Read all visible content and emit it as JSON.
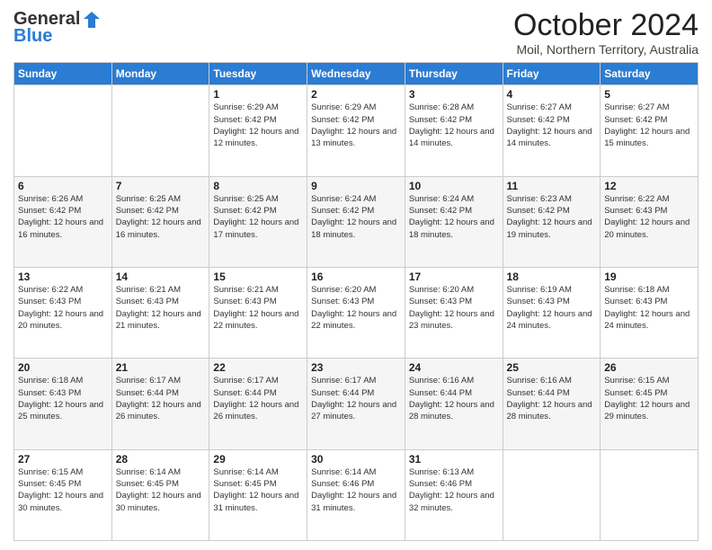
{
  "header": {
    "logo_line1": "General",
    "logo_line2": "Blue",
    "month": "October 2024",
    "location": "Moil, Northern Territory, Australia"
  },
  "weekdays": [
    "Sunday",
    "Monday",
    "Tuesday",
    "Wednesday",
    "Thursday",
    "Friday",
    "Saturday"
  ],
  "weeks": [
    [
      {
        "day": "",
        "info": ""
      },
      {
        "day": "",
        "info": ""
      },
      {
        "day": "1",
        "info": "Sunrise: 6:29 AM\nSunset: 6:42 PM\nDaylight: 12 hours and 12 minutes."
      },
      {
        "day": "2",
        "info": "Sunrise: 6:29 AM\nSunset: 6:42 PM\nDaylight: 12 hours and 13 minutes."
      },
      {
        "day": "3",
        "info": "Sunrise: 6:28 AM\nSunset: 6:42 PM\nDaylight: 12 hours and 14 minutes."
      },
      {
        "day": "4",
        "info": "Sunrise: 6:27 AM\nSunset: 6:42 PM\nDaylight: 12 hours and 14 minutes."
      },
      {
        "day": "5",
        "info": "Sunrise: 6:27 AM\nSunset: 6:42 PM\nDaylight: 12 hours and 15 minutes."
      }
    ],
    [
      {
        "day": "6",
        "info": "Sunrise: 6:26 AM\nSunset: 6:42 PM\nDaylight: 12 hours and 16 minutes."
      },
      {
        "day": "7",
        "info": "Sunrise: 6:25 AM\nSunset: 6:42 PM\nDaylight: 12 hours and 16 minutes."
      },
      {
        "day": "8",
        "info": "Sunrise: 6:25 AM\nSunset: 6:42 PM\nDaylight: 12 hours and 17 minutes."
      },
      {
        "day": "9",
        "info": "Sunrise: 6:24 AM\nSunset: 6:42 PM\nDaylight: 12 hours and 18 minutes."
      },
      {
        "day": "10",
        "info": "Sunrise: 6:24 AM\nSunset: 6:42 PM\nDaylight: 12 hours and 18 minutes."
      },
      {
        "day": "11",
        "info": "Sunrise: 6:23 AM\nSunset: 6:42 PM\nDaylight: 12 hours and 19 minutes."
      },
      {
        "day": "12",
        "info": "Sunrise: 6:22 AM\nSunset: 6:43 PM\nDaylight: 12 hours and 20 minutes."
      }
    ],
    [
      {
        "day": "13",
        "info": "Sunrise: 6:22 AM\nSunset: 6:43 PM\nDaylight: 12 hours and 20 minutes."
      },
      {
        "day": "14",
        "info": "Sunrise: 6:21 AM\nSunset: 6:43 PM\nDaylight: 12 hours and 21 minutes."
      },
      {
        "day": "15",
        "info": "Sunrise: 6:21 AM\nSunset: 6:43 PM\nDaylight: 12 hours and 22 minutes."
      },
      {
        "day": "16",
        "info": "Sunrise: 6:20 AM\nSunset: 6:43 PM\nDaylight: 12 hours and 22 minutes."
      },
      {
        "day": "17",
        "info": "Sunrise: 6:20 AM\nSunset: 6:43 PM\nDaylight: 12 hours and 23 minutes."
      },
      {
        "day": "18",
        "info": "Sunrise: 6:19 AM\nSunset: 6:43 PM\nDaylight: 12 hours and 24 minutes."
      },
      {
        "day": "19",
        "info": "Sunrise: 6:18 AM\nSunset: 6:43 PM\nDaylight: 12 hours and 24 minutes."
      }
    ],
    [
      {
        "day": "20",
        "info": "Sunrise: 6:18 AM\nSunset: 6:43 PM\nDaylight: 12 hours and 25 minutes."
      },
      {
        "day": "21",
        "info": "Sunrise: 6:17 AM\nSunset: 6:44 PM\nDaylight: 12 hours and 26 minutes."
      },
      {
        "day": "22",
        "info": "Sunrise: 6:17 AM\nSunset: 6:44 PM\nDaylight: 12 hours and 26 minutes."
      },
      {
        "day": "23",
        "info": "Sunrise: 6:17 AM\nSunset: 6:44 PM\nDaylight: 12 hours and 27 minutes."
      },
      {
        "day": "24",
        "info": "Sunrise: 6:16 AM\nSunset: 6:44 PM\nDaylight: 12 hours and 28 minutes."
      },
      {
        "day": "25",
        "info": "Sunrise: 6:16 AM\nSunset: 6:44 PM\nDaylight: 12 hours and 28 minutes."
      },
      {
        "day": "26",
        "info": "Sunrise: 6:15 AM\nSunset: 6:45 PM\nDaylight: 12 hours and 29 minutes."
      }
    ],
    [
      {
        "day": "27",
        "info": "Sunrise: 6:15 AM\nSunset: 6:45 PM\nDaylight: 12 hours and 30 minutes."
      },
      {
        "day": "28",
        "info": "Sunrise: 6:14 AM\nSunset: 6:45 PM\nDaylight: 12 hours and 30 minutes."
      },
      {
        "day": "29",
        "info": "Sunrise: 6:14 AM\nSunset: 6:45 PM\nDaylight: 12 hours and 31 minutes."
      },
      {
        "day": "30",
        "info": "Sunrise: 6:14 AM\nSunset: 6:46 PM\nDaylight: 12 hours and 31 minutes."
      },
      {
        "day": "31",
        "info": "Sunrise: 6:13 AM\nSunset: 6:46 PM\nDaylight: 12 hours and 32 minutes."
      },
      {
        "day": "",
        "info": ""
      },
      {
        "day": "",
        "info": ""
      }
    ]
  ]
}
